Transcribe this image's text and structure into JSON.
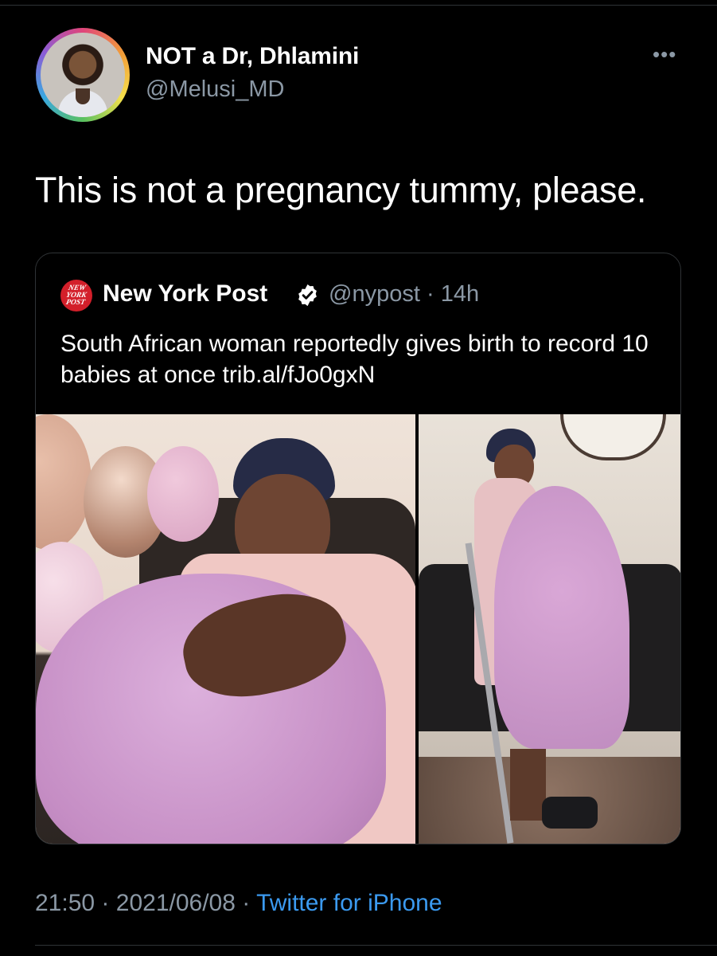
{
  "tweet": {
    "author": {
      "display_name": "NOT a Dr, Dhlamini",
      "handle": "@Melusi_MD"
    },
    "text": "This is not a pregnancy tummy, please.",
    "timestamp_time": "21:50",
    "timestamp_date": "2021/06/08",
    "source": "Twitter for iPhone",
    "separator": "·"
  },
  "quoted_tweet": {
    "logo_text": [
      "NEW",
      "YORK",
      "POST"
    ],
    "display_name": "New York Post",
    "handle": "@nypost",
    "age": "14h",
    "separator": "·",
    "text": "South African woman reportedly gives birth to record 10 babies at once trib.al/fJo0gxN"
  },
  "icons": {
    "more": "more-horizontal-icon",
    "verified": "verified-badge-icon"
  },
  "colors": {
    "background": "#000000",
    "secondary_text": "#8b98a5",
    "link": "#3b9af0",
    "verified_badge": "#ffffff",
    "nyp_red": "#d31f2a"
  }
}
